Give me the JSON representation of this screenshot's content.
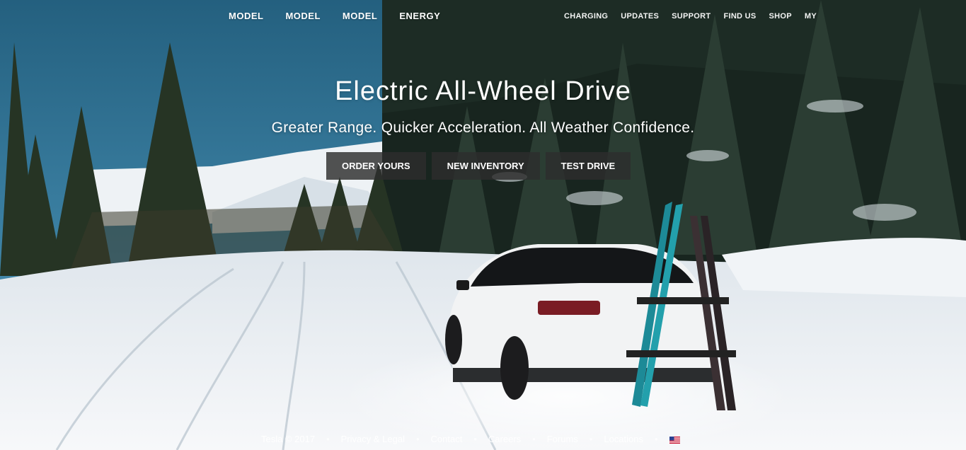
{
  "nav": {
    "primary": [
      "MODEL",
      "MODEL",
      "MODEL",
      "ENERGY"
    ],
    "secondary": [
      "CHARGING",
      "UPDATES",
      "SUPPORT",
      "FIND US",
      "SHOP",
      "MY"
    ]
  },
  "hero": {
    "headline": "Electric All-Wheel Drive",
    "subheadline": "Greater Range. Quicker Acceleration. All Weather Confidence."
  },
  "cta": {
    "order": "ORDER YOURS",
    "inventory": "NEW INVENTORY",
    "test_drive": "TEST DRIVE"
  },
  "footer": {
    "copyright": "Tesla © 2017",
    "privacy": "Privacy & Legal",
    "contact": "Contact",
    "careers": "Careers",
    "forums": "Forums",
    "locations": "Locations",
    "separator": "•",
    "region_icon": "us-flag-icon"
  },
  "colors": {
    "sky": "#2f6f91",
    "snow": "#f4f6f8",
    "forest": "#1f2a24",
    "button_bg": "#2d2d2d",
    "text": "#ffffff"
  }
}
